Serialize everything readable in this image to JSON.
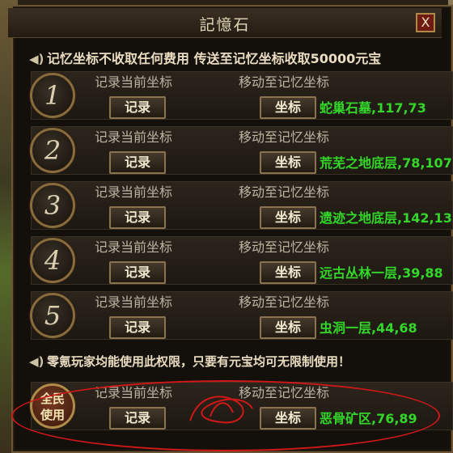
{
  "window": {
    "title": "記憶石",
    "close_label": "X"
  },
  "notice": {
    "top": "记忆坐标不收取任何费用 传送至记忆坐标收取50000元宝",
    "bottom": "零氪玩家均能使用此权限，只要有元宝均可无限制使用！"
  },
  "labels": {
    "record_current": "记录当前坐标",
    "move_to_memory": "移动至记忆坐标",
    "record_btn": "记录",
    "coord_btn": "坐标"
  },
  "slots": [
    {
      "badge": "1",
      "location": "蛇巢石墓,117,73"
    },
    {
      "badge": "2",
      "location": "荒芜之地底层,78,107"
    },
    {
      "badge": "3",
      "location": "遗迹之地底层,142,13"
    },
    {
      "badge": "4",
      "location": "远古丛林一层,39,88"
    },
    {
      "badge": "5",
      "location": "虫洞一层,44,68"
    }
  ],
  "special_slot": {
    "badge": "全民使用",
    "location": "恶骨矿区,76,89"
  },
  "colors": {
    "coord_text": "#33d629",
    "annotation": "#d01818"
  }
}
